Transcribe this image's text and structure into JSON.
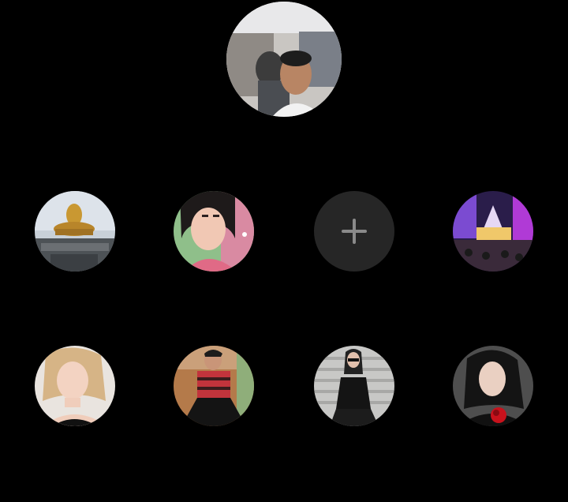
{
  "main_profile": {
    "icon": "profile-photo"
  },
  "friend_slots": [
    {
      "icon": "profile-photo"
    },
    {
      "icon": "profile-photo"
    },
    {
      "icon": "plus-icon",
      "kind": "add"
    },
    {
      "icon": "profile-photo"
    },
    {
      "icon": "profile-photo"
    },
    {
      "icon": "profile-photo"
    },
    {
      "icon": "profile-photo"
    },
    {
      "icon": "profile-photo"
    }
  ],
  "colors": {
    "background": "#000000",
    "add_slot": "#262626",
    "plus": "#8a8a8a"
  }
}
